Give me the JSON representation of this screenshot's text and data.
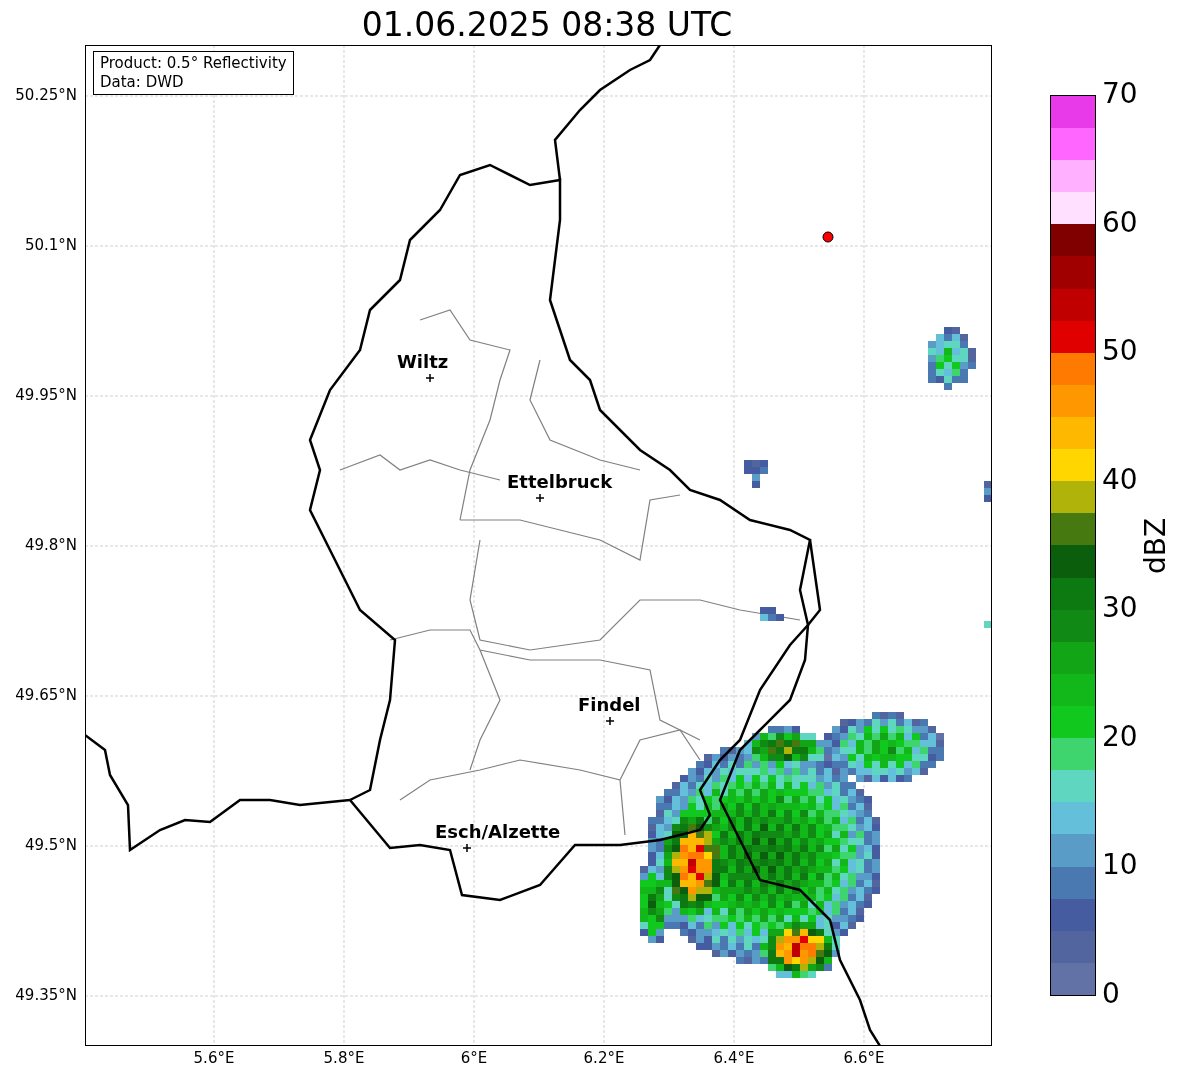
{
  "title": "01.06.2025 08:38 UTC",
  "info_box": [
    "Product: 0.5° Reflectivity",
    "Data: DWD"
  ],
  "lat_ticks": [
    "50.25°N",
    "50.1°N",
    "49.95°N",
    "49.8°N",
    "49.65°N",
    "49.5°N",
    "49.35°N"
  ],
  "lon_ticks": [
    "5.6°E",
    "5.8°E",
    "6°E",
    "6.2°E",
    "6.4°E",
    "6.6°E"
  ],
  "cities": [
    {
      "name": "Wiltz"
    },
    {
      "name": "Ettelbruck"
    },
    {
      "name": "Findel"
    },
    {
      "name": "Esch/Alzette"
    }
  ],
  "colorbar": {
    "label": "dBZ",
    "ticks": [
      "70",
      "60",
      "50",
      "40",
      "30",
      "20",
      "10",
      "0"
    ],
    "segments": [
      {
        "color": "#6272a6"
      },
      {
        "color": "#52659e"
      },
      {
        "color": "#455da0"
      },
      {
        "color": "#4a78b0"
      },
      {
        "color": "#5a9cc8"
      },
      {
        "color": "#63bfda"
      },
      {
        "color": "#5fd6c0"
      },
      {
        "color": "#3ed46e"
      },
      {
        "color": "#10c81e"
      },
      {
        "color": "#12b81a"
      },
      {
        "color": "#12a616"
      },
      {
        "color": "#108a14"
      },
      {
        "color": "#0c7a10"
      },
      {
        "color": "#0a5e0c"
      },
      {
        "color": "#467a10"
      },
      {
        "color": "#b0b40a"
      },
      {
        "color": "#ffd600"
      },
      {
        "color": "#ffb800"
      },
      {
        "color": "#ff9800"
      },
      {
        "color": "#ff7a00"
      },
      {
        "color": "#e00000"
      },
      {
        "color": "#c00000"
      },
      {
        "color": "#a00000"
      },
      {
        "color": "#800000"
      },
      {
        "color": "#ffe0ff"
      },
      {
        "color": "#ffb0ff"
      },
      {
        "color": "#ff66ff"
      },
      {
        "color": "#e83ae8"
      }
    ]
  }
}
